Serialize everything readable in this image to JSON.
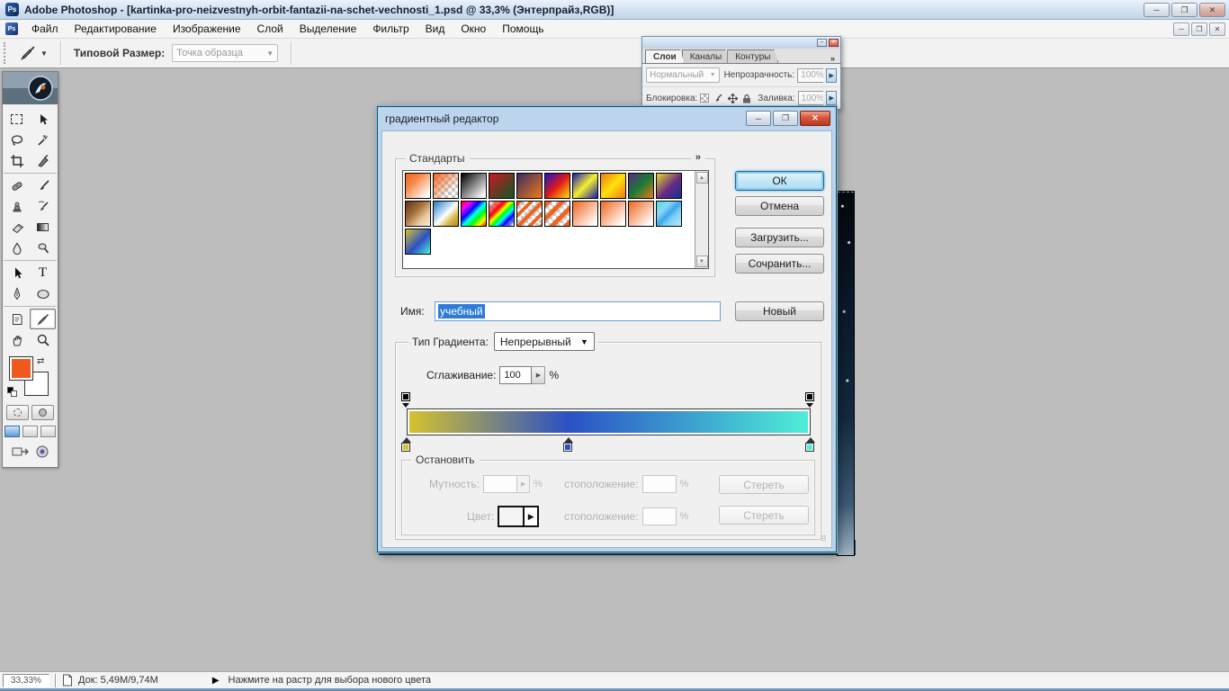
{
  "app": {
    "title": "Adobe Photoshop - [kartinka-pro-neizvestnyh-orbit-fantazii-na-schet-vechnosti_1.psd @ 33,3% (Энтерпрайз,RGB)]",
    "icon_text": "Ps",
    "menu": [
      "Файл",
      "Редактирование",
      "Изображение",
      "Слой",
      "Выделение",
      "Фильтр",
      "Вид",
      "Окно",
      "Помощь"
    ],
    "caption": {
      "minimize": "─",
      "restore": "❐",
      "close": "✕"
    }
  },
  "options_bar": {
    "sample_size_label": "Типовой Размер:",
    "sample_size_value": "Точка образца",
    "dropdown_arrow": "▼"
  },
  "toolbar": {
    "foreground_color": "#f0591e",
    "background_color": "#ffffff"
  },
  "layers_panel": {
    "tabs": {
      "layers": "Слои",
      "channels": "Каналы",
      "paths": "Контуры"
    },
    "overflow": "»",
    "blend_mode": "Нормальный",
    "opacity_label": "Непрозрачность:",
    "opacity_value": "100%",
    "lock_label": "Блокировка:",
    "fill_label": "Заливка:",
    "fill_value": "100%"
  },
  "dialog": {
    "title": "градиентный редактор",
    "presets": {
      "label": "Стандарты",
      "overflow": "»",
      "swatches": [
        {
          "name": "orange-white",
          "bg": "linear-gradient(135deg,#f0651e 0%,#f58a4a 35%,#ffffff 90%)"
        },
        {
          "name": "orange-transparent",
          "bg": "linear-gradient(135deg,#f0651e 0%,rgba(240,101,30,0) 75%),repeating-conic-gradient(#c8c8c8 0% 25%,#ffffff 0% 50%) 0 0/8px 8px"
        },
        {
          "name": "black-white",
          "bg": "linear-gradient(135deg,#000000 0%,#ffffff 92%)"
        },
        {
          "name": "red-green",
          "bg": "linear-gradient(135deg,#cc1622 0%,#0d5a26 100%)"
        },
        {
          "name": "violet-orange",
          "bg": "linear-gradient(135deg,#3a2b60 0%,#f07818 100%)"
        },
        {
          "name": "blue-red-yellow",
          "bg": "linear-gradient(135deg,#1616c8 0%,#e01818 50%,#ffe20a 100%)"
        },
        {
          "name": "blue-yellow-blue",
          "bg": "linear-gradient(135deg,#1a1ab2 0%,#f5ef2e 50%,#1a1ab2 100%)"
        },
        {
          "name": "orange-yellow-orange",
          "bg": "linear-gradient(135deg,#f07818 0%,#ffe20a 50%,#f07818 100%)"
        },
        {
          "name": "violet-green-orange",
          "bg": "linear-gradient(135deg,#5a2a80 0%,#1a7a34 50%,#f07818 100%)"
        },
        {
          "name": "yellow-violet-blue",
          "bg": "linear-gradient(135deg,#e8d829 0%,#6a2a84 55%,#10309a 100%)"
        },
        {
          "name": "copper",
          "bg": "linear-gradient(135deg,#5e3413 0%,#a5703d 40%,#e8c79a 70%,#f7efe2 100%)"
        },
        {
          "name": "chrome-gold",
          "bg": "linear-gradient(135deg,#2878c0 0%,#bcdcf4 40%,#ffffff 52%,#d8b84a 75%,#b08a20 100%)"
        },
        {
          "name": "spectrum",
          "bg": "linear-gradient(135deg,#ff0000 0%,#ff00ff 18%,#0000ff 38%,#00ffff 52%,#00ff00 68%,#ffff00 84%,#ff0000 100%)"
        },
        {
          "name": "transparent-rainbow",
          "bg": "linear-gradient(135deg,rgba(255,255,255,0) 0%,#ff0000 32%,#ffff00 44%,#00ff00 54%,#00ffff 64%,#0000ff 76%,rgba(255,255,255,0) 100%),repeating-conic-gradient(#c8c8c8 0% 25%,#ffffff 0% 50%) 0 0/8px 8px"
        },
        {
          "name": "orange-stripes",
          "bg": "repeating-linear-gradient(135deg,#f0651e 0 4px,rgba(255,255,255,0) 4px 9px),repeating-conic-gradient(#c8c8c8 0% 25%,#ffffff 0% 50%) 0 0/8px 8px"
        },
        {
          "name": "orange-stripes-wide",
          "bg": "repeating-linear-gradient(135deg,#f0651e 0 5px,rgba(255,255,255,0) 5px 11px),repeating-conic-gradient(#c8c8c8 0% 25%,#ffffff 0% 50%) 0 0/8px 8px"
        },
        {
          "name": "orange-white-2",
          "bg": "linear-gradient(135deg,#f0651e 0%,#ffffff 90%)"
        },
        {
          "name": "orange-white-3",
          "bg": "linear-gradient(135deg,#f0651e 0%,#ffffff 90%)"
        },
        {
          "name": "orange-white-4",
          "bg": "linear-gradient(135deg,#f0651e 0%,#ffffff 90%)"
        },
        {
          "name": "blue-cyan-stripes",
          "bg": "linear-gradient(135deg,#41e8e0 0%,#8fd4f6 30%,#38a8ec 50%,#7ecdf4 65%,#b4e8fb 100%)"
        },
        {
          "name": "gold-blue-cyan",
          "bg": "linear-gradient(135deg,#d6c32f 0%,#2b50c4 55%,#4fefd9 100%)"
        }
      ]
    },
    "buttons": {
      "ok": "ОК",
      "cancel": "Отмена",
      "load": "Загрузить...",
      "save": "Сочранить...",
      "new": "Новый"
    },
    "name_label": "Имя:",
    "name_value": "учебный",
    "type_label": "Тип Градиента:",
    "type_value": "Непрерывный",
    "smoothness_label": "Сглаживание:",
    "smoothness_value": "100",
    "percent": "%",
    "gradient": {
      "css": "linear-gradient(90deg,#d6c32f 0%,#2b50c4 40%,#4fefd9 100%)",
      "opacity_stops": [
        {
          "pos": 0,
          "color": "#000000"
        },
        {
          "pos": 100,
          "color": "#000000"
        }
      ],
      "color_stops": [
        {
          "pos": 0,
          "color": "#d6c32f"
        },
        {
          "pos": 40,
          "color": "#2b50c4"
        },
        {
          "pos": 100,
          "color": "#4fefd9"
        }
      ]
    },
    "stop_group": {
      "label": "Остановить",
      "opacity_label": "Мутность:",
      "location_label": "стоположение:",
      "delete_label": "Стереть",
      "color_label": "Цвет:"
    }
  },
  "status_bar": {
    "zoom": "33,33%",
    "doc_info": "Док: 5,49М/9,74М",
    "hint": "Нажмите на растр для выбора нового цвета",
    "play_glyph": "▶"
  }
}
